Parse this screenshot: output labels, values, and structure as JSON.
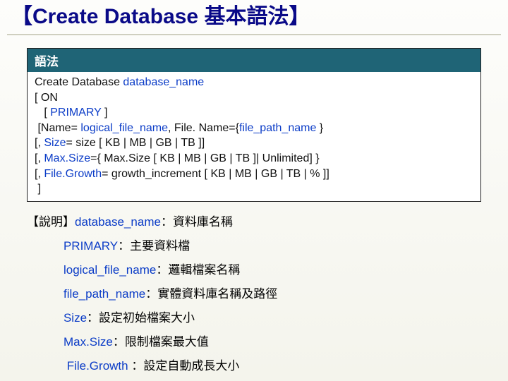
{
  "title": "【Create Database 基本語法】",
  "panel": {
    "header": "語法",
    "lines": {
      "l1a": "Create Database ",
      "l1b": "database_name",
      "l2": "[ ON",
      "l3a": "   [ ",
      "l3b": "PRIMARY",
      "l3c": " ]",
      "l4a": " [Name= ",
      "l4b": "logical_file_name",
      "l4c": ", File. Name={",
      "l4d": "file_path_name",
      "l4e": " }",
      "l5a": "[, ",
      "l5b": "Size",
      "l5c": "= size [ KB | MB | GB | TB ]]",
      "l6a": "[, ",
      "l6b": "Max.Size",
      "l6c": "={ Max.Size [ KB | MB | GB | TB ]| Unlimited] }",
      "l7a": "[, ",
      "l7b": "File.Growth",
      "l7c": "= growth_increment [ KB | MB | GB | TB | % ]]",
      "l8": " ]"
    }
  },
  "desc": {
    "intro": "【說明】",
    "d1": {
      "term": "database_name",
      "text": "：資料庫名稱"
    },
    "d2": {
      "term": "PRIMARY",
      "text": "：主要資料檔"
    },
    "d3": {
      "term": "logical_file_name",
      "text": "：邏輯檔案名稱"
    },
    "d4": {
      "term": "file_path_name",
      "text": "：實體資料庫名稱及路徑"
    },
    "d5": {
      "term": "Size",
      "text": "：設定初始檔案大小"
    },
    "d6": {
      "term": "Max.Size",
      "text": "：限制檔案最大值"
    },
    "d7": {
      "term": "File.Growth ",
      "text": "：設定自動成長大小"
    },
    "indent1": "           ",
    "indent2": "            "
  }
}
